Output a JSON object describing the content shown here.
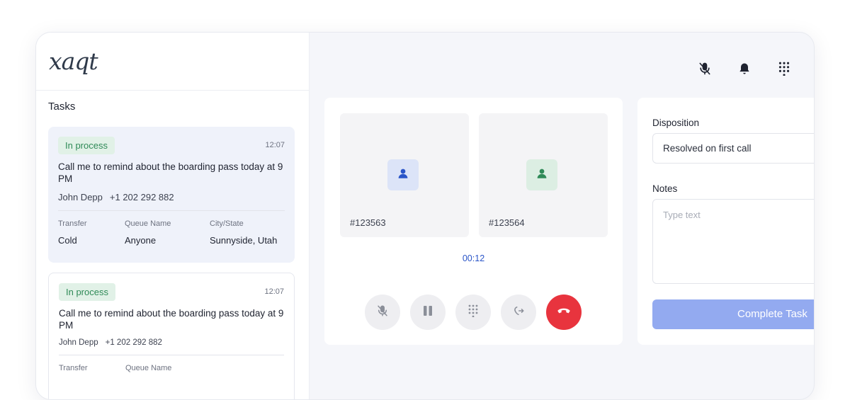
{
  "brand": {
    "logo_text": "xaqt"
  },
  "tasks": {
    "title": "Tasks",
    "items": [
      {
        "status": "In process",
        "time": "12:07",
        "title": "Call me to remind about the boarding pass today at 9 PM",
        "contact_name": "John Depp",
        "contact_phone": "+1 202 292 882",
        "meta_labels": [
          "Transfer",
          "Queue Name",
          "City/State"
        ],
        "meta_values": [
          "Cold",
          "Anyone",
          "Sunnyside, Utah"
        ]
      },
      {
        "status": "In process",
        "time": "12:07",
        "title": "Call me to remind about the boarding pass today at 9 PM",
        "contact_name": "John Depp",
        "contact_phone": "+1 202 292 882",
        "meta_labels": [
          "Transfer",
          "Queue Name"
        ]
      }
    ]
  },
  "header_icons": [
    "mic-off-icon",
    "bell-icon",
    "dialpad-icon"
  ],
  "call": {
    "participants": [
      {
        "id": "#123563",
        "color": "#2a55c8",
        "bg": "#dce4f8"
      },
      {
        "id": "#123564",
        "color": "#2f8a57",
        "bg": "#dceee3"
      }
    ],
    "timer": "00:12",
    "controls": [
      "mic-off-icon",
      "pause-icon",
      "dialpad-icon",
      "transfer-icon",
      "end-call-icon"
    ]
  },
  "disposition": {
    "label": "Disposition",
    "value": "Resolved on first call",
    "notes_label": "Notes",
    "notes_placeholder": "Type text",
    "complete_label": "Complete Task"
  },
  "colors": {
    "accent": "#2a55c8",
    "success": "#2f8a57",
    "danger": "#e8343e",
    "button": "#93aaf0"
  }
}
